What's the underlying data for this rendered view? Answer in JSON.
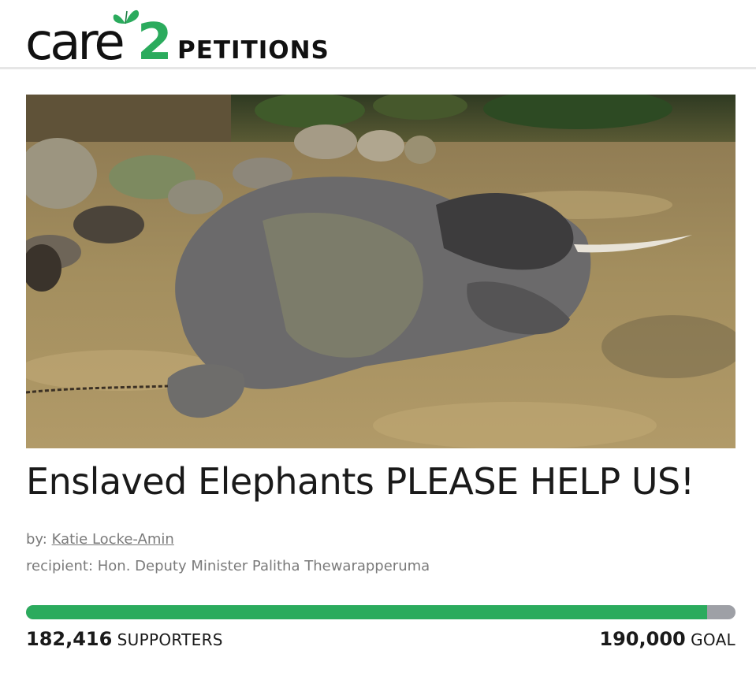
{
  "header": {
    "logo_word": "care",
    "logo_number": "2",
    "section": "PETITIONS",
    "brand_color": "#2bab5d"
  },
  "hero": {
    "icon": "photo-elephant-in-river"
  },
  "petition": {
    "title": "Enslaved Elephants PLEASE HELP US!",
    "by_label": "by:",
    "author": "Katie Locke-Amin",
    "recipient_label": "recipient:",
    "recipient": "Hon. Deputy Minister Palitha Thewarapperuma"
  },
  "progress": {
    "supporters": "182,416",
    "supporters_label": "SUPPORTERS",
    "goal": "190,000",
    "goal_label": "GOAL",
    "fraction": 0.96,
    "fill_color": "#2bab5d",
    "track_color": "#9ea0a6"
  }
}
